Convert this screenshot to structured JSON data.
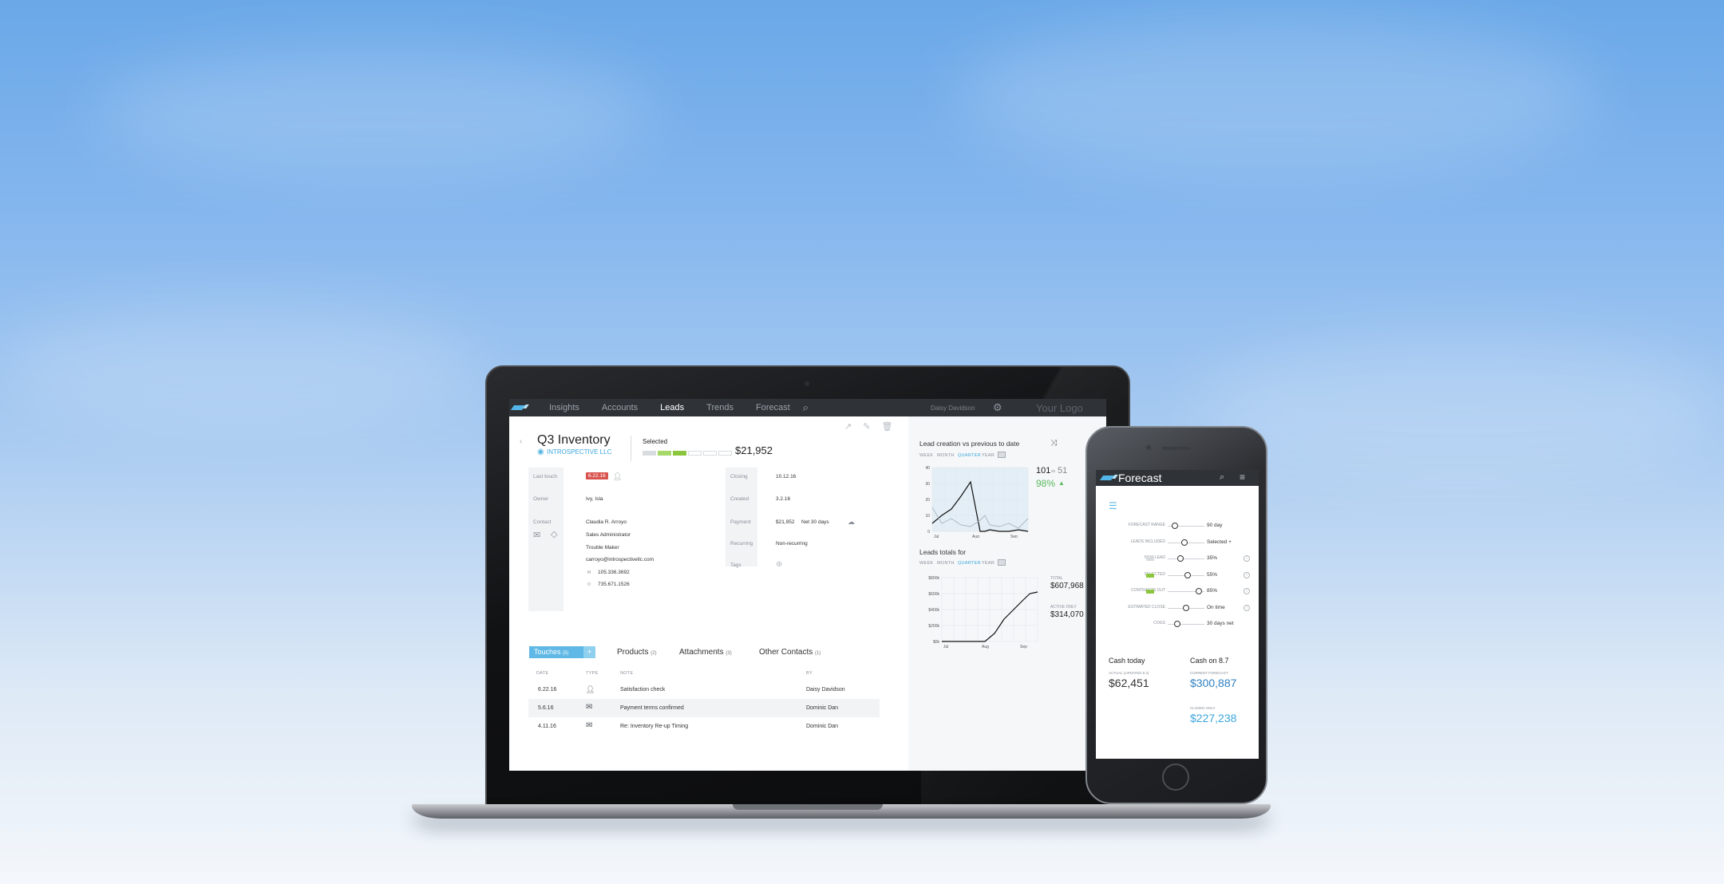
{
  "nav": {
    "items": [
      "Insights",
      "Accounts",
      "Leads",
      "Trends",
      "Forecast"
    ],
    "active": "Leads",
    "user": "Daisy Davidson",
    "logo_text": "Your Logo"
  },
  "lead": {
    "title": "Q3 Inventory",
    "company": "INTROSPECTIVE LLC",
    "selected_label": "Selected",
    "amount": "$21,952",
    "stage_colors": [
      "#d9dcde",
      "#a6d86a",
      "#8cc63f",
      "#ffffff",
      "#ffffff",
      "#ffffff"
    ],
    "left_fields": {
      "last_touch_label": "Last touch",
      "last_touch_value": "6.22.16",
      "owner_label": "Owner",
      "owner_value": "Ivy, Isla",
      "contact_label": "Contact",
      "contact_name": "Claudia R. Arroyo",
      "contact_title": "Sales Administrator",
      "contact_role": "Trouble Maker",
      "contact_email": "carroyo@introspectivellc.com",
      "contact_m_label": "M",
      "contact_mobile": "105.336.3692",
      "contact_o_label": "O",
      "contact_office": "735.671.1526"
    },
    "right_fields": {
      "closing_label": "Closing",
      "closing_value": "10.12.16",
      "created_label": "Created",
      "created_value": "3.2.16",
      "payment_label": "Payment",
      "payment_amount": "$21,952",
      "payment_terms": "Net 30 days",
      "recurring_label": "Recurring",
      "recurring_value": "Non-recurring",
      "tags_label": "Tags"
    }
  },
  "tabs": {
    "touches_label": "Touches",
    "touches_count": "(5)",
    "products_label": "Products",
    "products_count": "(2)",
    "attachments_label": "Attachments",
    "attachments_count": "(3)",
    "contacts_label": "Other Contacts",
    "contacts_count": "(1)"
  },
  "touches_table": {
    "headers": [
      "DATE",
      "TYPE",
      "NOTE",
      "BY"
    ],
    "rows": [
      {
        "date": "6.22.16",
        "type": "person-icon",
        "note": "Satisfaction check",
        "by": "Daisy Davidson"
      },
      {
        "date": "5.6.16",
        "type": "mail-icon",
        "note": "Payment terms confirmed",
        "by": "Dominic Dan"
      },
      {
        "date": "4.11.16",
        "type": "mail-icon",
        "note": "Re: Inventory Re-up Timing",
        "by": "Dominic Dan"
      }
    ]
  },
  "periods": [
    "WEEK",
    "MONTH",
    "QUARTER",
    "YEAR"
  ],
  "active_period": "QUARTER",
  "chart_data": [
    {
      "type": "line",
      "title": "Lead creation vs previous to date",
      "categories": [
        "Jul",
        "Aug",
        "Sep"
      ],
      "ylim": [
        0,
        40
      ],
      "yticks": [
        "40",
        "30",
        "20",
        "10",
        "0"
      ],
      "x": [
        0,
        0.1,
        0.2,
        0.3,
        0.4,
        0.5,
        0.55,
        0.6,
        0.7,
        0.8,
        0.9,
        1.0
      ],
      "series": [
        {
          "values": [
            5,
            10,
            14,
            22,
            31,
            0,
            0,
            1,
            0,
            0,
            1,
            0
          ]
        },
        {
          "values": [
            15,
            5,
            8,
            4,
            3,
            7,
            10,
            4,
            3,
            5,
            2,
            8
          ]
        }
      ],
      "summary_current": "101",
      "summary_separator": "vs",
      "summary_previous": "51",
      "summary_percent": "98%"
    },
    {
      "type": "line",
      "title": "Leads totals for",
      "categories": [
        "Jul",
        "Aug",
        "Sep"
      ],
      "ylim": [
        0,
        800
      ],
      "yticks": [
        "$800k",
        "$600k",
        "$400k",
        "$200k",
        "$0k"
      ],
      "x": [
        0,
        0.2,
        0.45,
        0.55,
        0.65,
        0.75,
        0.85,
        0.92,
        1.0
      ],
      "series": [
        {
          "values": [
            0,
            0,
            0,
            100,
            280,
            400,
            520,
            600,
            620
          ]
        }
      ],
      "total_label": "TOTAL",
      "total_value": "$607,968",
      "active_label": "ACTIVE ONLY",
      "active_value": "$314,070"
    }
  ],
  "phone": {
    "title": "Forecast",
    "sliders": [
      {
        "label": "FORECAST RANGE",
        "value": "90 day",
        "level": 0.2
      },
      {
        "label": "LEADS INCLUDED",
        "value": "Selected +",
        "level": 0.45
      },
      {
        "label": "NEW LEAD",
        "value": "35%",
        "level": 0.35
      },
      {
        "label": "SELECTED",
        "value": "55%",
        "level": 0.55
      },
      {
        "label": "CONTRACTS OUT",
        "value": "85%",
        "level": 0.85
      },
      {
        "label": "ESTIMATED CLOSE",
        "value": "On time",
        "level": 0.5
      },
      {
        "label": "COGS",
        "value": "30 days net",
        "level": 0.27
      }
    ],
    "cash_today_label": "Cash today",
    "actual_label": "ACTUAL (UPDATED 8.2)",
    "actual_value": "$62,451",
    "cash_on_label": "Cash on 8.7",
    "current_forecast_label": "CURRENT FORECAST",
    "current_forecast_value": "$300,887",
    "closed_only_label": "CLOSED ONLY",
    "closed_only_value": "$227,238"
  }
}
